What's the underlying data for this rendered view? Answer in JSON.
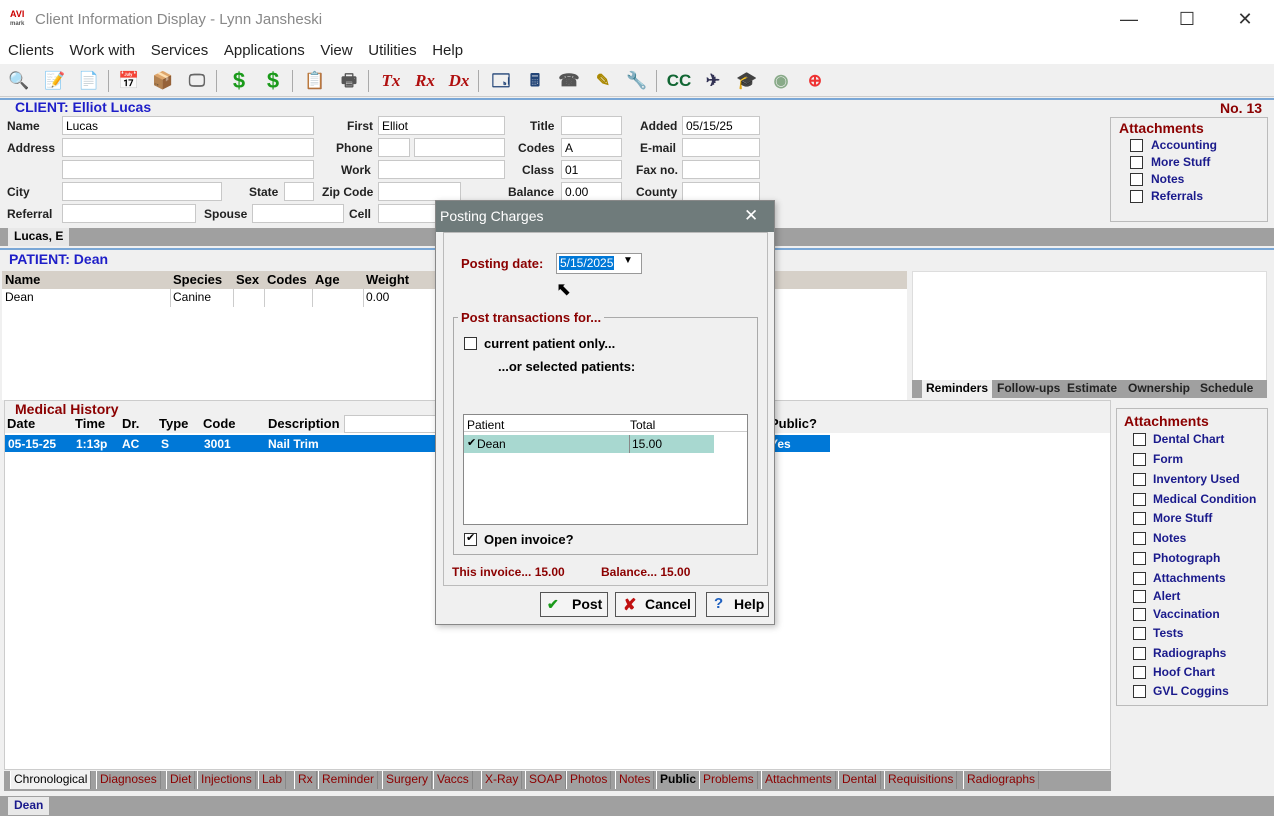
{
  "window": {
    "logo": "AVI mark",
    "title": "Client Information Display - Lynn Jansheski",
    "minimize": "—",
    "maximize": "☐",
    "close": "✕"
  },
  "menu": [
    "Clients",
    "Work with",
    "Services",
    "Applications",
    "View",
    "Utilities",
    "Help"
  ],
  "client": {
    "header": "CLIENT:  Elliot Lucas",
    "number": "No. 13",
    "labels": {
      "name": "Name",
      "address": "Address",
      "city": "City",
      "state": "State",
      "zip": "Zip Code",
      "referral": "Referral",
      "spouse": "Spouse",
      "cell": "Cell",
      "first": "First",
      "phone": "Phone",
      "work": "Work",
      "title": "Title",
      "codes": "Codes",
      "class": "Class",
      "balance": "Balance",
      "added": "Added",
      "email": "E-mail",
      "fax": "Fax no.",
      "county": "County"
    },
    "values": {
      "name": "Lucas",
      "first": "Elliot",
      "codes": "A",
      "class": "01",
      "balance": "0.00",
      "added": "05/15/25"
    },
    "tab": "Lucas, E"
  },
  "client_attachments": {
    "title": "Attachments",
    "items": [
      "Accounting",
      "More Stuff",
      "Notes",
      "Referrals"
    ]
  },
  "patient": {
    "header": "PATIENT:  Dean",
    "columns": [
      "Name",
      "Species",
      "Sex",
      "Codes",
      "Age",
      "Weight"
    ],
    "row": {
      "name": "Dean",
      "species": "Canine",
      "sex": "",
      "codes": "",
      "age": "",
      "weight": "0.00"
    },
    "tab": "Dean"
  },
  "reminder_tabs": [
    "Reminders",
    "Follow-ups",
    "Estimate",
    "Ownership",
    "Schedule"
  ],
  "medical_history": {
    "title": "Medical History",
    "columns": [
      "Date",
      "Time",
      "Dr.",
      "Type",
      "Code",
      "Description",
      "Public?"
    ],
    "row": {
      "date": "05-15-25",
      "time": "1:13p",
      "dr": "AC",
      "type": "S",
      "code": "3001",
      "description": "Nail Trim",
      "public": "Yes"
    }
  },
  "history_tabs": [
    "Chronological",
    "Diagnoses",
    "Diet",
    "Injections",
    "Lab",
    "Rx",
    "Reminder",
    "Surgery",
    "Vaccs",
    "X-Ray",
    "SOAP",
    "Photos",
    "Notes",
    "Public",
    "Problems",
    "Attachments",
    "Dental",
    "Requisitions",
    "Radiographs"
  ],
  "patient_attachments": {
    "title": "Attachments",
    "items": [
      "Dental Chart",
      "Form",
      "Inventory Used",
      "Medical Condition",
      "More Stuff",
      "Notes",
      "Photograph",
      "Attachments",
      "Alert",
      "Vaccination",
      "Tests",
      "Radiographs",
      "Hoof Chart",
      "GVL Coggins"
    ]
  },
  "dialog": {
    "title": "Posting Charges",
    "close": "✕",
    "posting_date_label": "Posting date:",
    "posting_date_value": "5/15/2025",
    "group_label": "Post transactions for...",
    "current_only": "current patient only...",
    "or_selected": "...or selected patients:",
    "columns": [
      "Patient",
      "Total"
    ],
    "patient_row": {
      "check": "✔",
      "name": "Dean",
      "total": "15.00"
    },
    "open_invoice": "Open invoice?",
    "open_invoice_check": "✔",
    "this_invoice": "This invoice... 15.00",
    "balance": "Balance... 15.00",
    "post": "Post",
    "cancel": "Cancel",
    "help": "Help",
    "post_icon": "✔",
    "cancel_icon": "✘",
    "help_icon": "?"
  },
  "colors": {
    "selection": "#0078d7",
    "dialog_title": "#6f7b7b",
    "patient_row_bg": "#a8d8d0",
    "maroon": "#8b0000",
    "blue_header": "#1e1ec8"
  }
}
